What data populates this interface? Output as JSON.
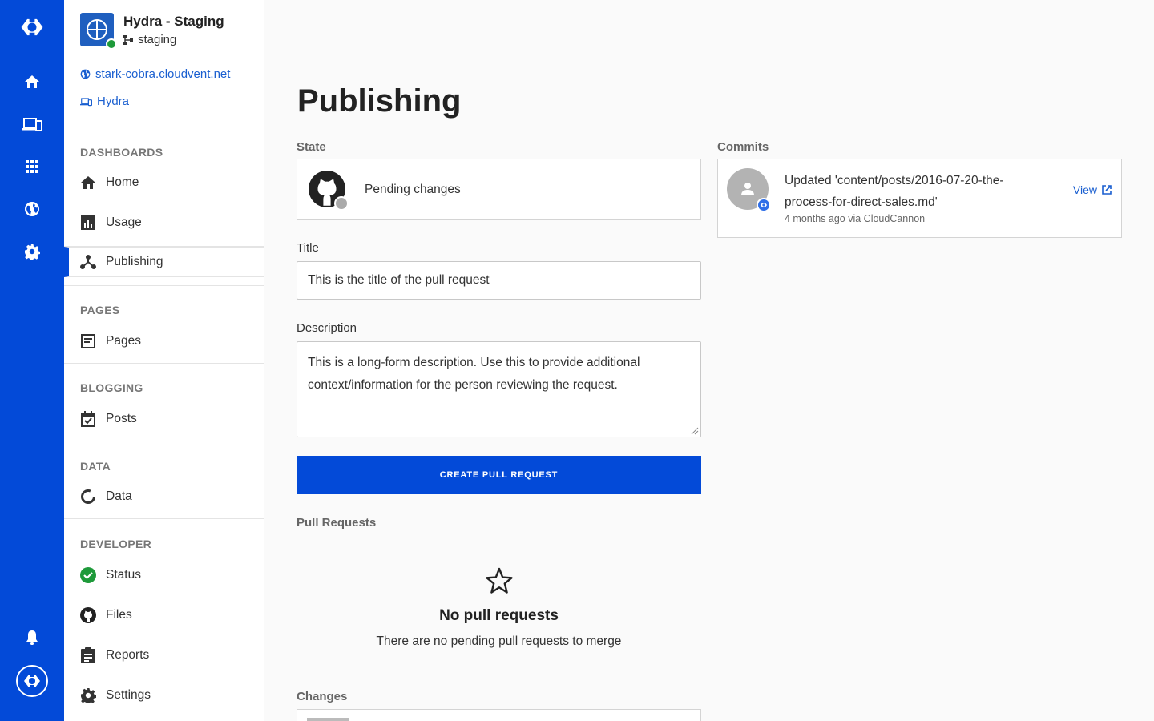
{
  "rail": {
    "items": [
      "home-icon",
      "devices-icon",
      "apps-grid-icon",
      "globe-icon",
      "settings-icon"
    ],
    "bottom": [
      "bell-icon",
      "account-logo-icon"
    ]
  },
  "site": {
    "name": "Hydra - Staging",
    "branch": "staging",
    "domain": "stark-cobra.cloudvent.net",
    "project": "Hydra"
  },
  "sidebar": {
    "sections": {
      "dashboards": "DASHBOARDS",
      "pages": "PAGES",
      "blogging": "BLOGGING",
      "data": "DATA",
      "developer": "DEVELOPER"
    },
    "items": {
      "home": "Home",
      "usage": "Usage",
      "publishing": "Publishing",
      "pages": "Pages",
      "posts": "Posts",
      "data": "Data",
      "status": "Status",
      "files": "Files",
      "reports": "Reports",
      "settings": "Settings"
    }
  },
  "main": {
    "title": "Publishing",
    "state_label": "State",
    "state_value": "Pending changes",
    "title_label": "Title",
    "title_value": "This is the title of the pull request",
    "description_label": "Description",
    "description_value": "This is a long-form description. Use this to provide additional context/information for the person reviewing the request.",
    "create_button": "CREATE PULL REQUEST",
    "pull_requests_label": "Pull Requests",
    "empty_title": "No pull requests",
    "empty_text": "There are no pending pull requests to merge",
    "changes_label": "Changes"
  },
  "commits": {
    "label": "Commits",
    "message": "Updated 'content/posts/2016-07-20-the-process-for-direct-sales.md'",
    "meta": "4 months ago via CloudCannon",
    "view": "View"
  },
  "colors": {
    "brand": "#034ad8",
    "link": "#1a5fd0",
    "success": "#1e9a3a"
  }
}
